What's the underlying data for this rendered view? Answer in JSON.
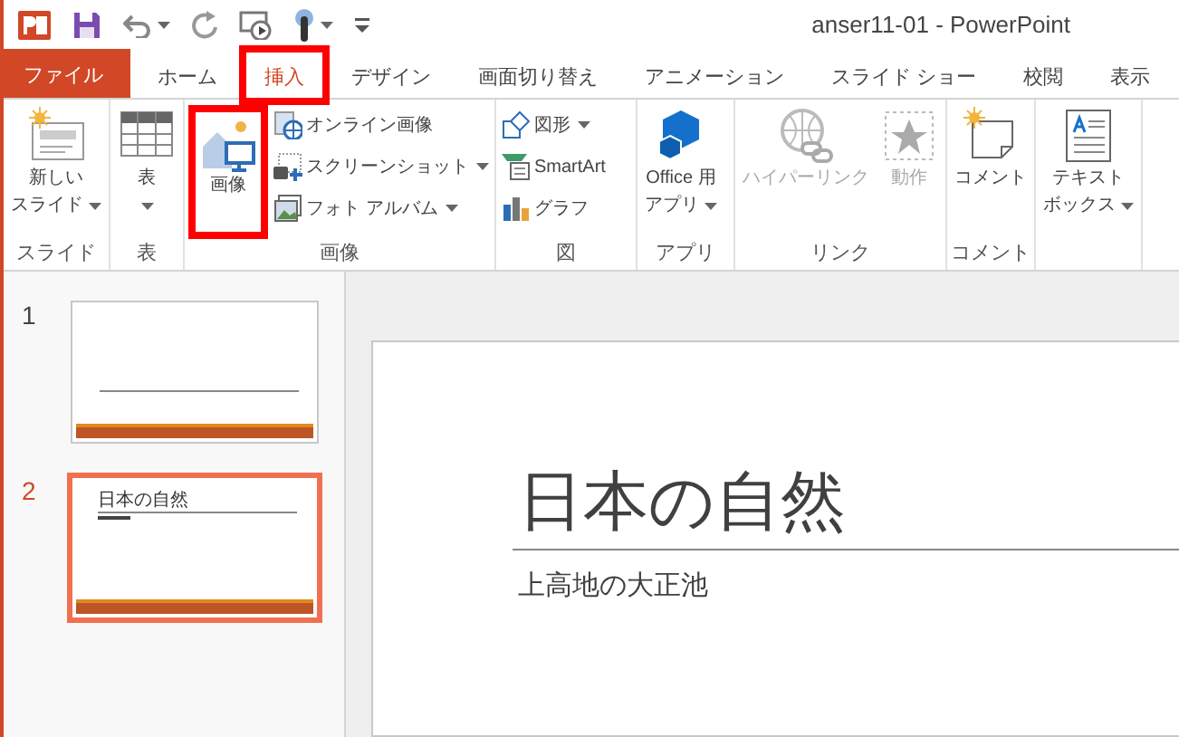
{
  "window": {
    "title": "anser11-01 - PowerPoint"
  },
  "tabs": [
    {
      "label": "ファイル",
      "kind": "file",
      "selected": false,
      "highlighted": false
    },
    {
      "label": "ホーム",
      "kind": "tab",
      "selected": false,
      "highlighted": false
    },
    {
      "label": "挿入",
      "kind": "tab",
      "selected": true,
      "highlighted": true
    },
    {
      "label": "デザイン",
      "kind": "tab",
      "selected": false,
      "highlighted": false
    },
    {
      "label": "画面切り替え",
      "kind": "tab",
      "selected": false,
      "highlighted": false
    },
    {
      "label": "アニメーション",
      "kind": "tab",
      "selected": false,
      "highlighted": false
    },
    {
      "label": "スライド ショー",
      "kind": "tab",
      "selected": false,
      "highlighted": false
    },
    {
      "label": "校閲",
      "kind": "tab",
      "selected": false,
      "highlighted": false
    },
    {
      "label": "表示",
      "kind": "tab",
      "selected": false,
      "highlighted": false
    }
  ],
  "ribbon_groups": [
    {
      "label": "スライド",
      "items": [
        {
          "kind": "large",
          "lines": [
            "新しい",
            "スライド"
          ],
          "dropdown": true,
          "disabled": false,
          "highlighted": false
        }
      ]
    },
    {
      "label": "表",
      "items": [
        {
          "kind": "large",
          "lines": [
            "表"
          ],
          "dropdown": true,
          "disabled": false,
          "highlighted": false
        }
      ]
    },
    {
      "label": "画像",
      "items": [
        {
          "kind": "large",
          "lines": [
            "画像"
          ],
          "dropdown": false,
          "disabled": false,
          "highlighted": true
        },
        {
          "kind": "small",
          "lines": [
            "オンライン画像"
          ],
          "dropdown": false,
          "disabled": false,
          "highlighted": false
        },
        {
          "kind": "small",
          "lines": [
            "スクリーンショット"
          ],
          "dropdown": true,
          "disabled": false,
          "highlighted": false
        },
        {
          "kind": "small",
          "lines": [
            "フォト アルバム"
          ],
          "dropdown": true,
          "disabled": false,
          "highlighted": false
        }
      ]
    },
    {
      "label": "図",
      "items": [
        {
          "kind": "small",
          "lines": [
            "図形"
          ],
          "dropdown": true,
          "disabled": false,
          "highlighted": false
        },
        {
          "kind": "small",
          "lines": [
            "SmartArt"
          ],
          "dropdown": false,
          "disabled": false,
          "highlighted": false
        },
        {
          "kind": "small",
          "lines": [
            "グラフ"
          ],
          "dropdown": false,
          "disabled": false,
          "highlighted": false
        }
      ]
    },
    {
      "label": "アプリ",
      "items": [
        {
          "kind": "large",
          "lines": [
            "Office 用",
            "アプリ"
          ],
          "dropdown": true,
          "disabled": false,
          "highlighted": false
        }
      ]
    },
    {
      "label": "リンク",
      "items": [
        {
          "kind": "large",
          "lines": [
            "ハイパーリンク"
          ],
          "dropdown": false,
          "disabled": true,
          "highlighted": false
        },
        {
          "kind": "large",
          "lines": [
            "動作"
          ],
          "dropdown": false,
          "disabled": true,
          "highlighted": false
        }
      ]
    },
    {
      "label": "コメント",
      "items": [
        {
          "kind": "large",
          "lines": [
            "コメント"
          ],
          "dropdown": false,
          "disabled": false,
          "highlighted": false
        }
      ]
    },
    {
      "items": [
        {
          "kind": "large",
          "lines": [
            "テキスト",
            "ボックス"
          ],
          "dropdown": true,
          "disabled": false,
          "highlighted": false
        }
      ]
    }
  ],
  "slides": [
    {
      "number": "1",
      "selected": false
    },
    {
      "number": "2",
      "selected": true,
      "title": "日本の自然"
    }
  ],
  "editor": {
    "title": "日本の自然",
    "subtitle": "上高地の大正池"
  }
}
